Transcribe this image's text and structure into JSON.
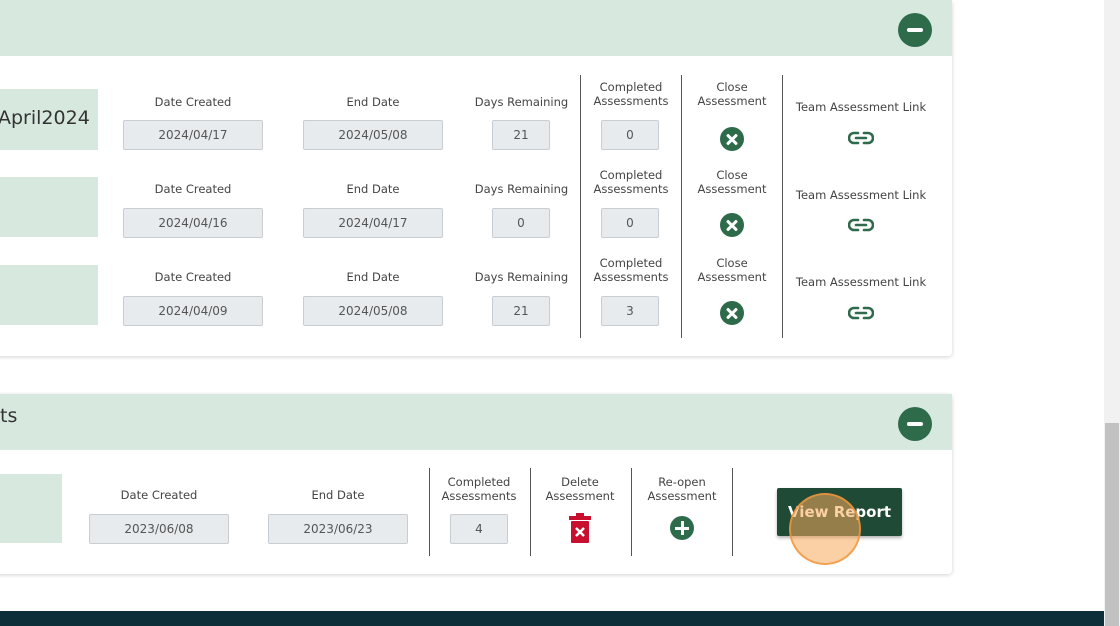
{
  "card1": {
    "name": "April2024",
    "rows": [
      {
        "date_created": "2024/04/17",
        "end_date": "2024/05/08",
        "days_remaining": "21",
        "completed": "0"
      },
      {
        "date_created": "2024/04/16",
        "end_date": "2024/04/17",
        "days_remaining": "0",
        "completed": "0"
      },
      {
        "date_created": "2024/04/09",
        "end_date": "2024/05/08",
        "days_remaining": "21",
        "completed": "3"
      }
    ],
    "labels": {
      "date_created": "Date Created",
      "end_date": "End Date",
      "days_remaining": "Days Remaining",
      "completed_1": "Completed",
      "completed_2": "Assessments",
      "close_1": "Close",
      "close_2": "Assessment",
      "team_link": "Team Assessment Link"
    }
  },
  "card2": {
    "title": "ts",
    "row": {
      "date_created": "2023/06/08",
      "end_date": "2023/06/23",
      "completed": "4"
    },
    "labels": {
      "date_created": "Date Created",
      "end_date": "End Date",
      "completed_1": "Completed",
      "completed_2": "Assessments",
      "delete_1": "Delete",
      "delete_2": "Assessment",
      "reopen_1": "Re-open",
      "reopen_2": "Assessment"
    },
    "view_report": "View Report"
  },
  "colors": {
    "accent": "#2e6b4b",
    "header_bg": "#d7e9df",
    "danger": "#c8102e",
    "footer": "#0c2f3a"
  }
}
